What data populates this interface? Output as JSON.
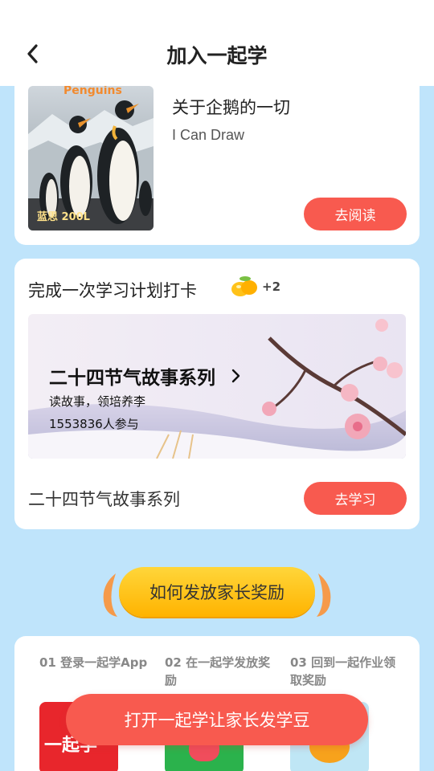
{
  "header": {
    "title": "加入一起学"
  },
  "book": {
    "cover_word": "Penguins",
    "cover_level": "蓝思 200L",
    "title": "关于企鹅的一切",
    "author": "I Can Draw",
    "read_label": "去阅读"
  },
  "task": {
    "title": "完成一次学习计划打卡",
    "reward_count": "+2",
    "banner": {
      "title": "二十四节气故事系列",
      "subtitle": "读故事，领培养李",
      "participants": "1553836人参与"
    },
    "series_name": "二十四节气故事系列",
    "study_label": "去学习"
  },
  "how": {
    "label": "如何发放家长奖励"
  },
  "steps": [
    {
      "text": "01 登录一起学App"
    },
    {
      "text": "02 在一起学发放奖励"
    },
    {
      "text": "03 回到一起作业领取奖励"
    }
  ],
  "step_thumbs": {
    "first_text": "一起学"
  },
  "open_button": {
    "label": "打开一起学让家长发学豆"
  },
  "colors": {
    "accent": "#f85a4f",
    "background": "#bfe4fb",
    "gold": "#ffc21a"
  }
}
